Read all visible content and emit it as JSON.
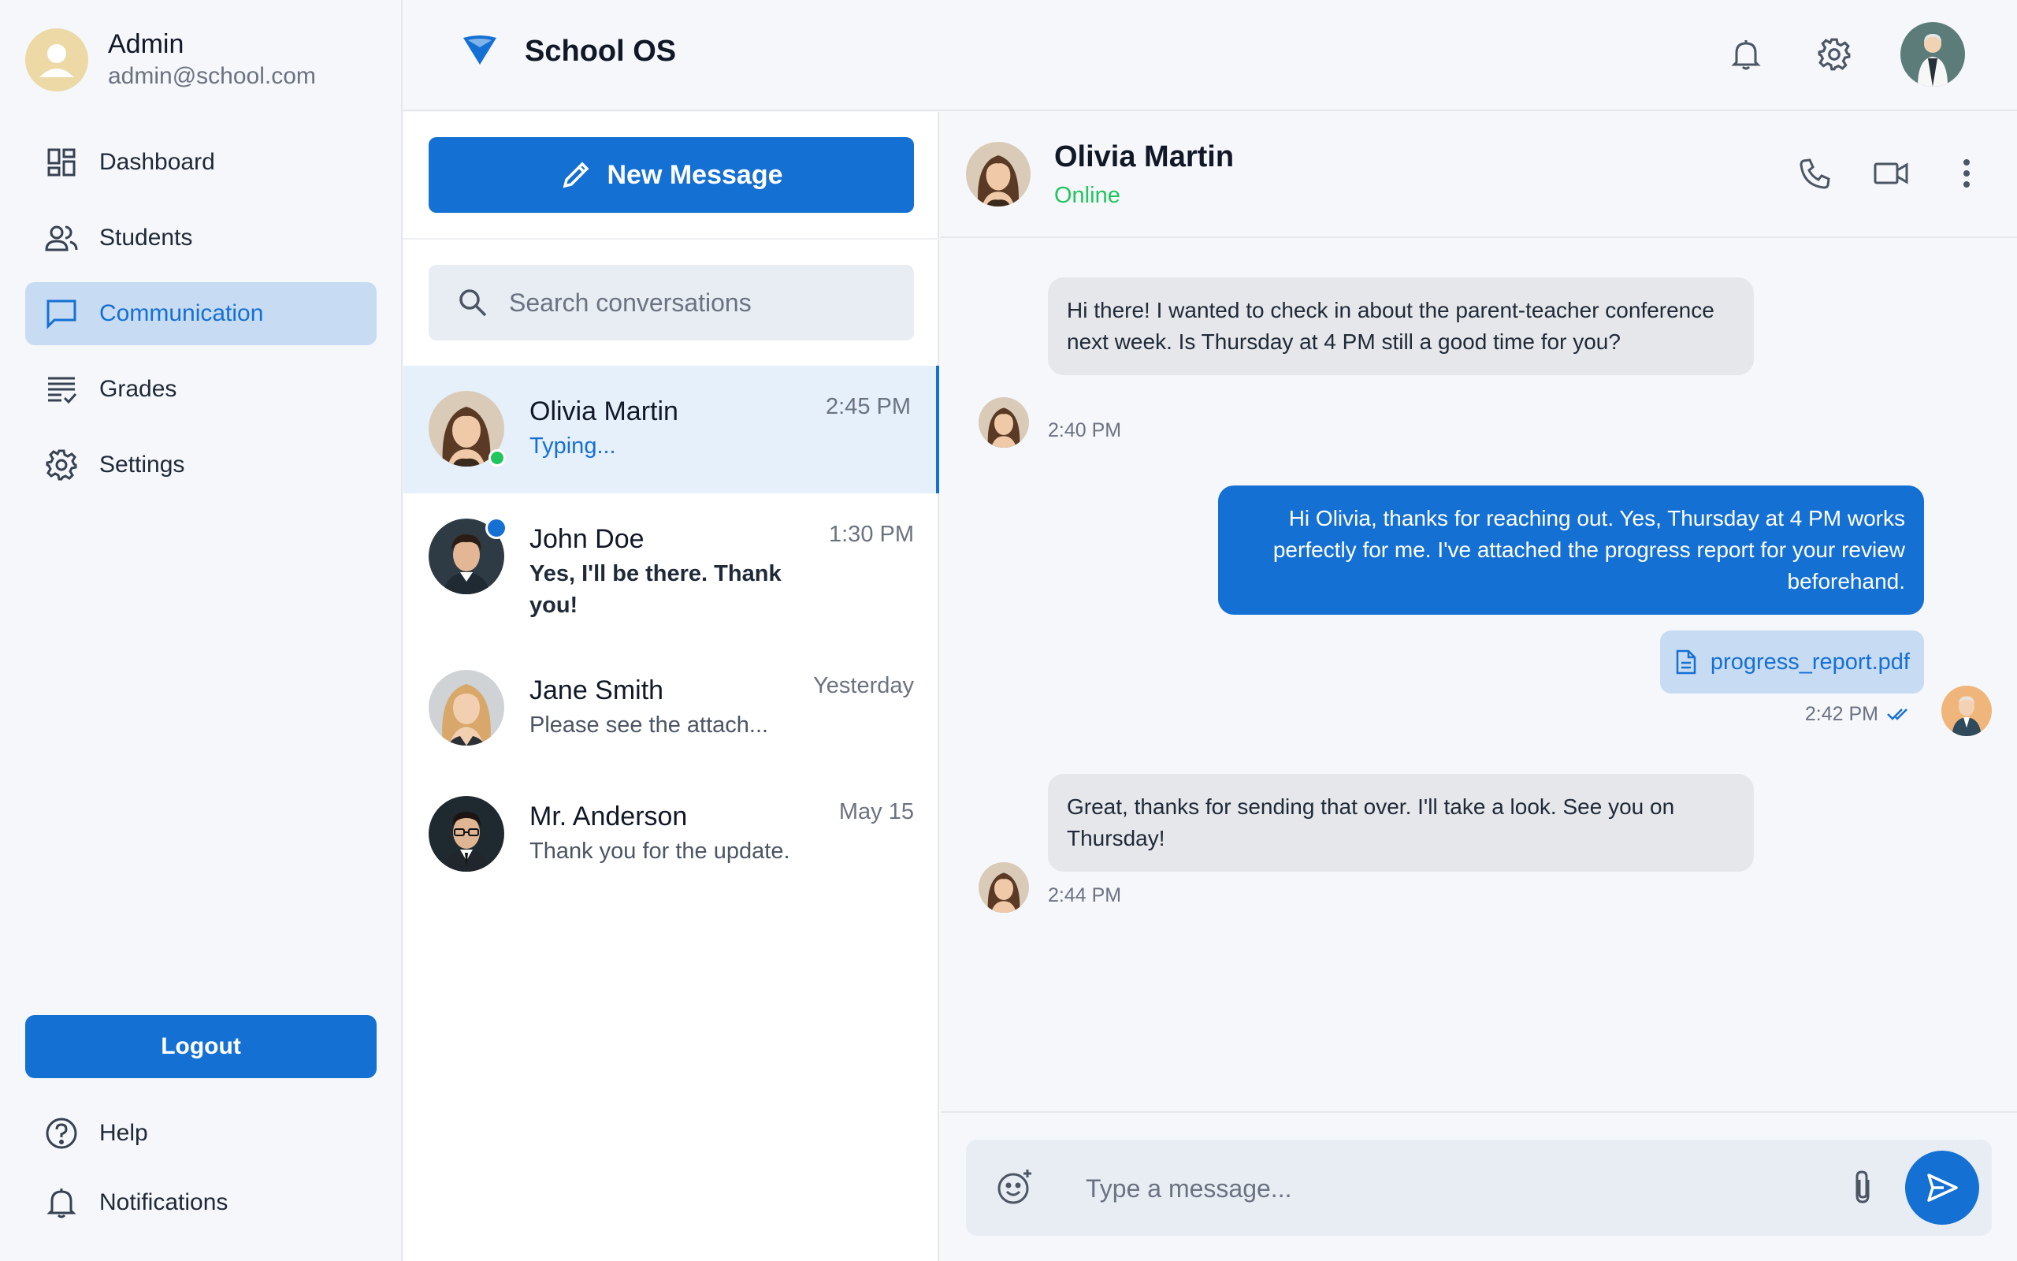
{
  "profile": {
    "name": "Admin",
    "email": "admin@school.com"
  },
  "sidebar": {
    "items": [
      {
        "label": "Dashboard",
        "icon": "dashboard-icon"
      },
      {
        "label": "Students",
        "icon": "users-icon"
      },
      {
        "label": "Communication",
        "icon": "chat-icon",
        "active": true
      },
      {
        "label": "Grades",
        "icon": "grades-icon"
      },
      {
        "label": "Settings",
        "icon": "gear-icon"
      }
    ],
    "logout_label": "Logout",
    "bottom_items": [
      {
        "label": "Help",
        "icon": "help-icon"
      },
      {
        "label": "Notifications",
        "icon": "bell-icon"
      }
    ]
  },
  "header": {
    "app_name": "School OS"
  },
  "conversations": {
    "new_message_label": "New Message",
    "search_placeholder": "Search conversations",
    "items": [
      {
        "name": "Olivia Martin",
        "time": "2:45 PM",
        "preview": "Typing...",
        "active": true,
        "online": true
      },
      {
        "name": "John Doe",
        "time": "1:30 PM",
        "preview": "Yes, I'll be there. Thank you!",
        "unread": true
      },
      {
        "name": "Jane Smith",
        "time": "Yesterday",
        "preview": "Please see the attach..."
      },
      {
        "name": "Mr. Anderson",
        "time": "May 15",
        "preview": "Thank you for the update."
      }
    ]
  },
  "chat": {
    "contact_name": "Olivia Martin",
    "contact_status": "Online",
    "messages": [
      {
        "direction": "in",
        "text": "Hi there! I wanted to check in about the parent-teacher conference next week. Is Thursday at 4 PM still a good time for you?",
        "time": "2:40 PM"
      },
      {
        "direction": "out",
        "text": "Hi Olivia, thanks for reaching out. Yes, Thursday at 4 PM works perfectly for me. I've attached the progress report for your review beforehand.",
        "attachment": "progress_report.pdf",
        "time": "2:42 PM",
        "read": true
      },
      {
        "direction": "in",
        "text": "Great, thanks for sending that over. I'll take a look. See you on Thursday!",
        "time": "2:44 PM"
      }
    ],
    "composer_placeholder": "Type a message..."
  },
  "colors": {
    "accent": "#1570d4",
    "online": "#22c55e",
    "active_nav_bg": "#c7dbf2",
    "incoming_bubble": "#e5e7ea"
  }
}
